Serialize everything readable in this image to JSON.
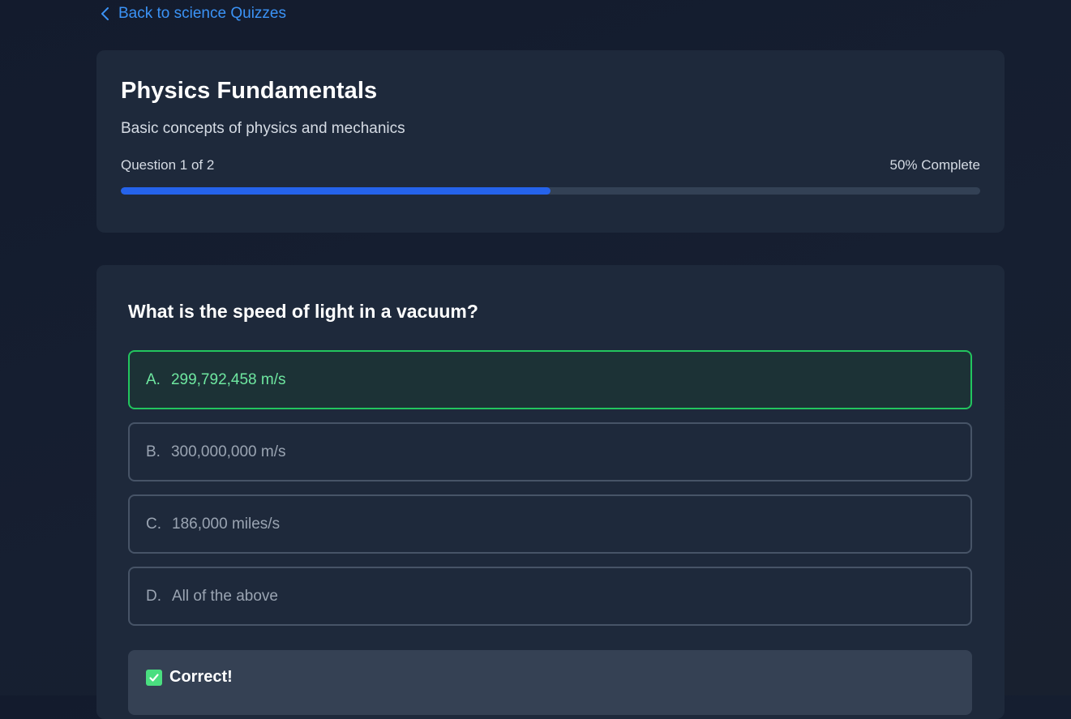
{
  "back_link": {
    "label": "Back to science Quizzes"
  },
  "quiz": {
    "title": "Physics Fundamentals",
    "description": "Basic concepts of physics and mechanics",
    "progress_label": "Question 1 of 2",
    "progress_percent_label": "50% Complete",
    "progress_fraction": 0.5
  },
  "question": {
    "text": "What is the speed of light in a vacuum?",
    "options": [
      {
        "letter": "A.",
        "text": "299,792,458 m/s",
        "state": "correct"
      },
      {
        "letter": "B.",
        "text": "300,000,000 m/s",
        "state": "default"
      },
      {
        "letter": "C.",
        "text": "186,000 miles/s",
        "state": "default"
      },
      {
        "letter": "D.",
        "text": "All of the above",
        "state": "default"
      }
    ]
  },
  "feedback": {
    "title": "Correct!",
    "icon": "check-box-icon"
  },
  "colors": {
    "accent": "#3b93f6",
    "progress": "#2563eb",
    "correct": "#22c55e"
  }
}
